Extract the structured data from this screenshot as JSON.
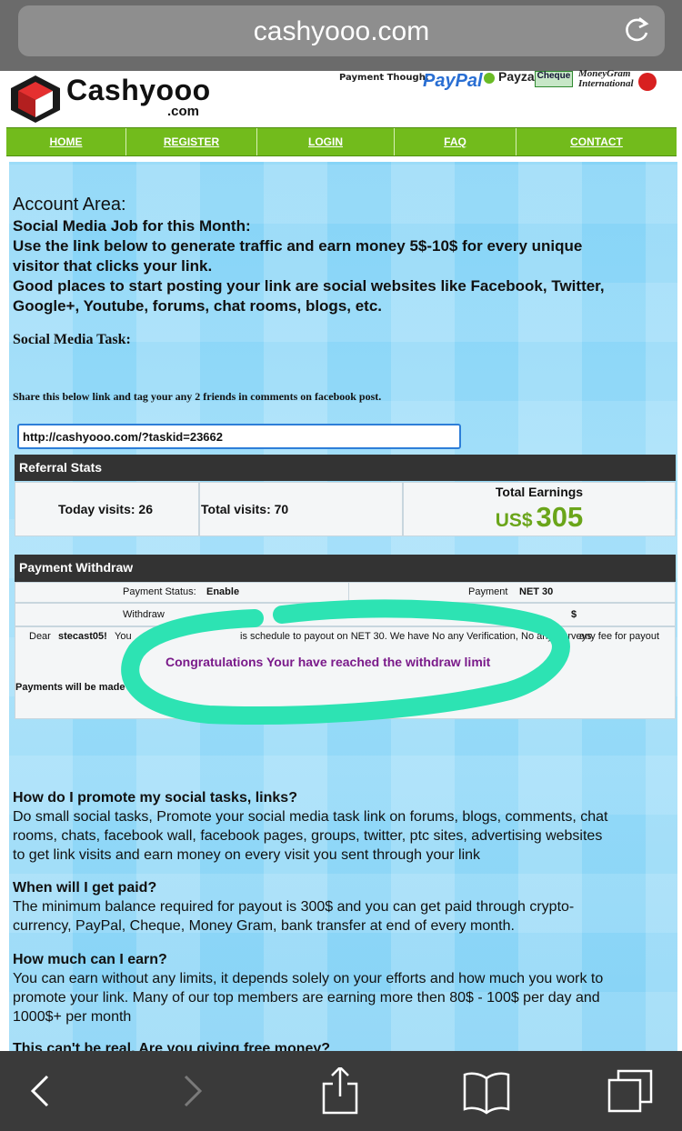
{
  "browser": {
    "url": "cashyooo.com"
  },
  "header": {
    "logo_name": "Cashyooo",
    "logo_domain": ".com",
    "payment_label": "Payment Though:",
    "payment_methods": [
      "PayPal",
      "Payza",
      "Cheque",
      "MoneyGram International"
    ]
  },
  "nav": {
    "items": [
      "HOME",
      "REGISTER",
      "LOGIN",
      "FAQ",
      "CONTACT"
    ]
  },
  "account": {
    "title": "Account Area:",
    "lines": [
      "Social Media Job for this Month:",
      "Use the link below to generate traffic and earn money 5$-10$ for every unique",
      "visitor that clicks your link.",
      "Good places to start posting your link are social websites like Facebook, Twitter,",
      "Google+, Youtube, forums, chat rooms, blogs, etc."
    ],
    "task_title": "Social Media Task:",
    "share_text": "Share this below link and tag your any 2 friends in comments on facebook post.",
    "link_value": "http://cashyooo.com/?taskid=23662"
  },
  "referral": {
    "header": "Referral Stats",
    "today_visits": "Today visits: 26",
    "total_visits": "Total visits: 70",
    "total_earnings_label": "Total Earnings",
    "currency": "US$",
    "amount": "305"
  },
  "payment": {
    "header": "Payment Withdraw",
    "status_label": "Payment Status:",
    "status_value": "Enable",
    "payment_label": "Payment",
    "payment_value": "NET 30",
    "withdraw_label": "Withdraw",
    "withdraw_suffix": "$",
    "dear_prefix": "Dear",
    "username": "stecast05!",
    "msg_you": "You",
    "msg_mid": "is schedule to payout on NET 30. We have No any Verification, No any Surveys",
    "msg_end": "any fee for payout",
    "congrats": "Congratulations Your have reached the withdraw limit",
    "payments_made": "Payments will be made NE"
  },
  "faq": [
    {
      "q": "How do I promote my social tasks, links?",
      "a": [
        "Do small social tasks, Promote your social media task link on forums, blogs, comments, chat",
        "rooms, chats, facebook wall, facebook pages, groups, twitter, ptc sites, advertising websites",
        "to get link visits and earn money on every visit you sent through your link"
      ]
    },
    {
      "q": "When will I get paid?",
      "a": [
        "The minimum balance required for payout is 300$ and you can get paid through crypto-",
        "currency, PayPal, Cheque, Money Gram, bank transfer at end of every month."
      ]
    },
    {
      "q": "How much can I earn?",
      "a": [
        "You can earn without any limits, it depends solely on your efforts and how much you work to",
        "promote your link. Many of our top members are earning more then 80$ - 100$ per day and",
        "1000$+ per month"
      ]
    },
    {
      "q": "This can't be real. Are you giving free money?",
      "a": []
    }
  ],
  "colors": {
    "nav_green": "#72bb1c",
    "earnings_green": "#6aa51a",
    "congrats_purple": "#7a1a8a",
    "highlight_marker": "#2de3b3"
  },
  "toolbar": {
    "icons": [
      "back-icon",
      "forward-icon",
      "share-icon",
      "bookmarks-icon",
      "tabs-icon"
    ]
  }
}
